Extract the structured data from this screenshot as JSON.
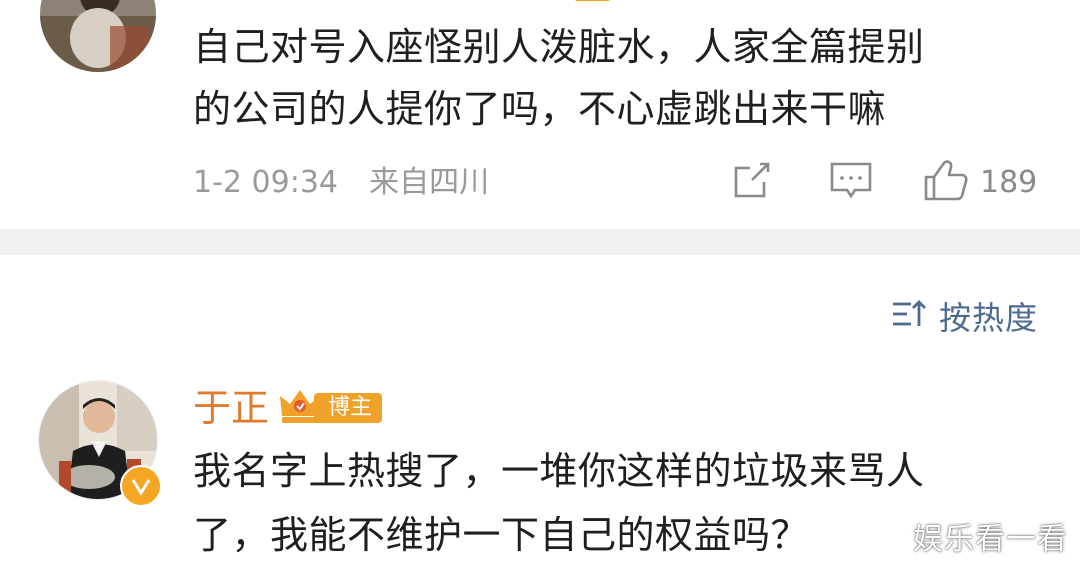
{
  "comment_top": {
    "text_line1": "自己对号入座怪别人泼脏水，人家全篇提别",
    "text_line2": "的公司的人提你了吗，不心虚跳出来干嘛",
    "timestamp": "1-2 09:34",
    "location": "来自四川",
    "like_count": "189",
    "icons": [
      "share-icon",
      "comment-icon",
      "like-icon"
    ]
  },
  "sort": {
    "label": "按热度",
    "icon": "sort-icon"
  },
  "comment_author": {
    "name": "于正",
    "badge_label": "博主",
    "badge_color": "#f0a12a",
    "name_color": "#e07b2e",
    "text_line1": "我名字上热搜了，一堆你这样的垃圾来骂人",
    "text_line2": "了，我能不维护一下自己的权益吗？"
  },
  "watermark": "娱乐看一看"
}
